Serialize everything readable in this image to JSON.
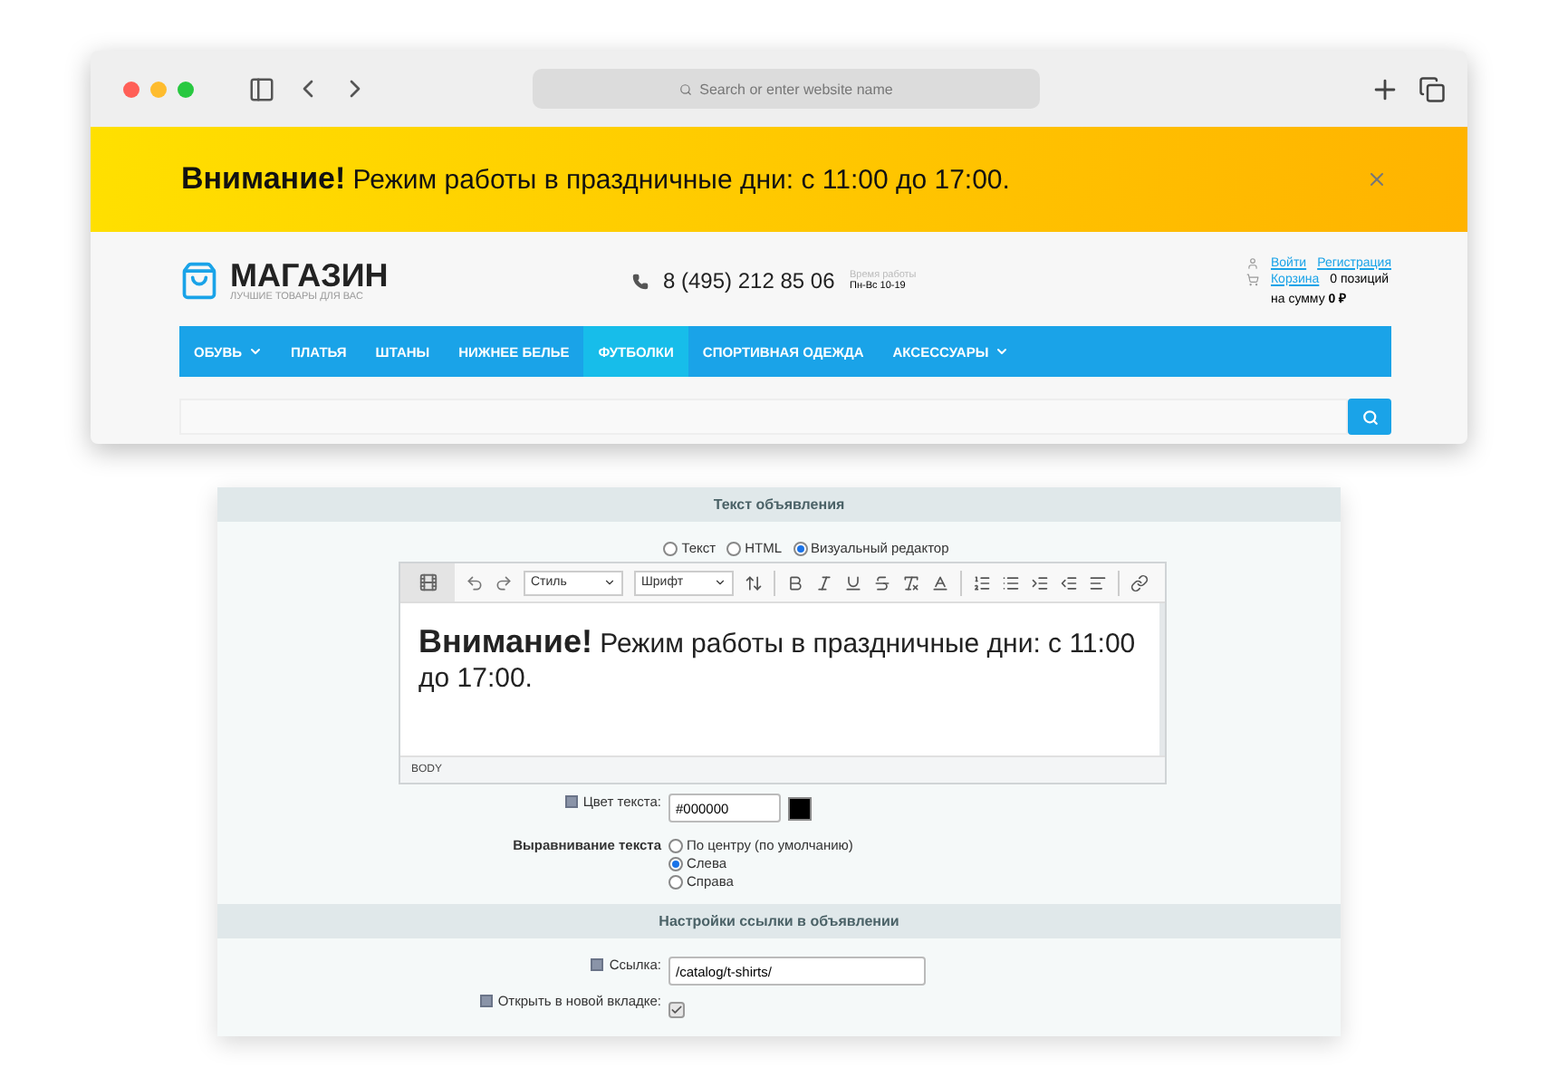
{
  "browser": {
    "address_placeholder": "Search or enter website name"
  },
  "banner": {
    "text": "**Внимание!** Режим работы в праздничные дни: с 11:00 до 17:00."
  },
  "site": {
    "logo": {
      "name": "МАГАЗИН",
      "tagline": "ЛУЧШИЕ ТОВАРЫ ДЛЯ ВАС"
    },
    "phone": "8 (495) 212 85 06",
    "hours": {
      "label": "Время работы",
      "value": "Пн-Вс 10-19"
    },
    "account": {
      "login": "Войти",
      "register": "Регистрация",
      "cart": "Корзина",
      "cart_count": "0 позиций",
      "sum": "на сумму **0 ₽**"
    }
  },
  "nav": [
    {
      "label": "ОБУВЬ",
      "selected": false,
      "dropdown": true
    },
    {
      "label": "ПЛАТЬЯ",
      "selected": false,
      "dropdown": false
    },
    {
      "label": "ШТАНЫ",
      "selected": false,
      "dropdown": false
    },
    {
      "label": "НИЖНЕЕ БЕЛЬЕ",
      "selected": false,
      "dropdown": false
    },
    {
      "label": "ФУТБОЛКИ",
      "selected": true,
      "dropdown": false
    },
    {
      "label": "СПОРТИВНАЯ ОДЕЖДА",
      "selected": false,
      "dropdown": false
    },
    {
      "label": "АКСЕССУАРЫ",
      "selected": false,
      "dropdown": true
    }
  ],
  "admin": {
    "section_title": "Текст объявления",
    "modes": [
      {
        "label": "Текст",
        "selected": false
      },
      {
        "label": "HTML",
        "selected": false
      },
      {
        "label": "Визуальный редактор",
        "selected": true
      }
    ],
    "editor": {
      "style_select": "Стиль",
      "font_select": "Шрифт",
      "content": "**Внимание!** Режим работы в праздничные дни: с 11:00 до 17:00.",
      "status": "BODY"
    },
    "text_color": {
      "label": "Цвет текста:",
      "value": "#000000"
    },
    "alignment": {
      "label": "Выравнивание текста",
      "options": [
        {
          "label": "По центру (по умолчанию)",
          "selected": false
        },
        {
          "label": "Слева",
          "selected": true
        },
        {
          "label": "Справа",
          "selected": false
        }
      ]
    },
    "link_section_title": "Настройки ссылки в объявлении",
    "link": {
      "label": "Ссылка:",
      "value": "/catalog/t-shirts/"
    },
    "new_tab": {
      "label": "Открыть в новой вкладке:",
      "checked": true
    }
  }
}
